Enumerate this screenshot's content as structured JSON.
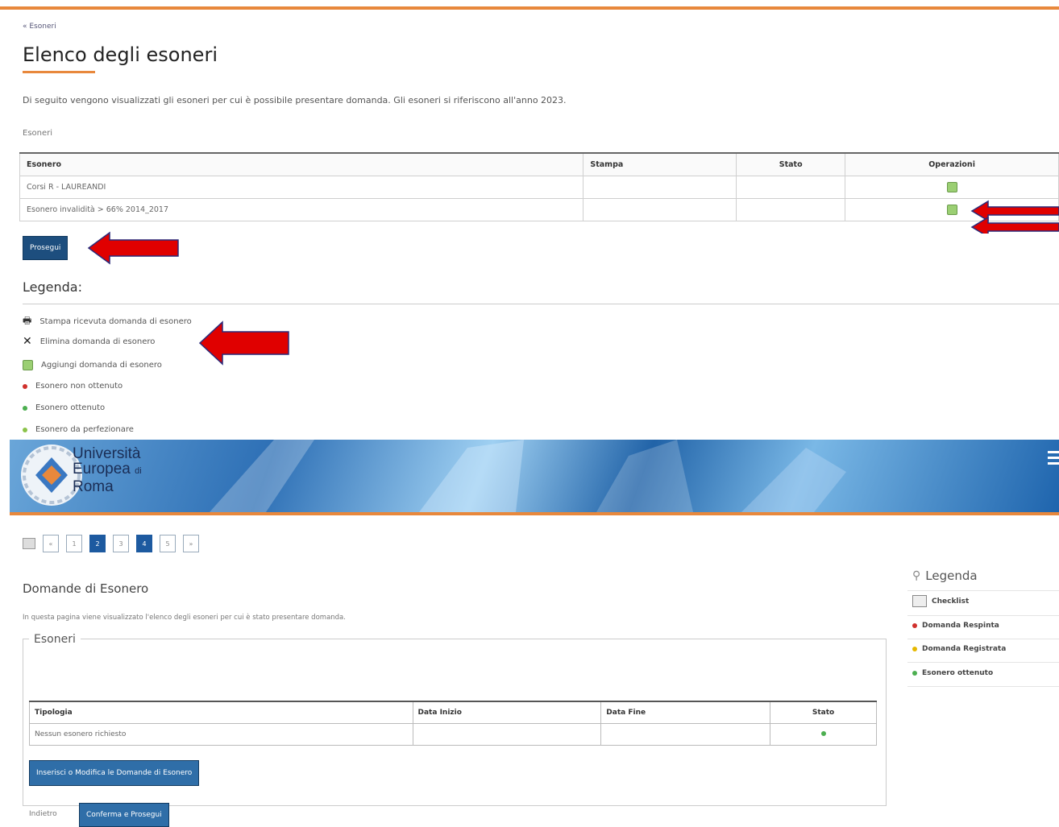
{
  "top": {
    "breadcrumb": "« Esoneri",
    "title": "Elenco degli esoneri",
    "intro": "Di seguito vengono visualizzati gli esoneri per cui è possibile presentare domanda. Gli esoneri si riferiscono all'anno 2023.",
    "section_label": "Esoneri",
    "table": {
      "headers": [
        "Esonero",
        "Stampa",
        "Stato",
        "Operazioni"
      ],
      "rows": [
        {
          "esonero": "Corsi R - LAUREANDI"
        },
        {
          "esonero": "Esonero invalidità > 66% 2014_2017"
        }
      ]
    },
    "prosegui_label": "Prosegui",
    "legend_title": "Legenda:",
    "legend": [
      {
        "icon": "printer-icon",
        "label": "Stampa ricevuta domanda di esonero"
      },
      {
        "icon": "close-icon",
        "label": "Elimina domanda di esonero"
      },
      {
        "icon": "edit-icon",
        "label": "Aggiungi domanda di esonero"
      },
      {
        "icon": "red-dot-icon",
        "label": "Esonero non ottenuto",
        "color": "#d0312d"
      },
      {
        "icon": "green-dot-icon",
        "label": "Esonero ottenuto",
        "color": "#4caf50"
      },
      {
        "icon": "yellow-dot-icon",
        "label": "Esonero da perfezionare",
        "color": "#8bc34a"
      }
    ]
  },
  "banner": {
    "logo_line1": "Università",
    "logo_line2": "Europea",
    "logo_line2_small": "di",
    "logo_line3": "Roma"
  },
  "bottom": {
    "pager": [
      "«",
      "1",
      "2",
      "3",
      "4",
      "5",
      "»"
    ],
    "title": "Domande di Esonero",
    "intro": "In questa pagina viene visualizzato l'elenco degli esoneri per cui è stato presentare domanda.",
    "fieldset_legend": "Esoneri",
    "table": {
      "headers": [
        "Tipologia",
        "Data Inizio",
        "Data Fine",
        "Stato"
      ],
      "rows": [
        {
          "tipologia": "Nessun esonero richiesto",
          "data_inizio": "",
          "data_fine": ""
        }
      ]
    },
    "insert_button": "Inserisci o Modifica le Domande di Esonero",
    "back_label": "Indietro",
    "confirm_button": "Conferma e Prosegui"
  },
  "sidebar": {
    "title": "Legenda",
    "items": [
      {
        "label": "Checklist",
        "icon": "checklist-icon"
      },
      {
        "label": "Domanda Respinta",
        "color": "#d0312d"
      },
      {
        "label": "Domanda Registrata",
        "color": "#e6b800"
      },
      {
        "label": "Esonero ottenuto",
        "color": "#4caf50"
      }
    ]
  },
  "colors": {
    "accent": "#e8883c",
    "button": "#1d4e7e",
    "arrow": "#e00000"
  }
}
